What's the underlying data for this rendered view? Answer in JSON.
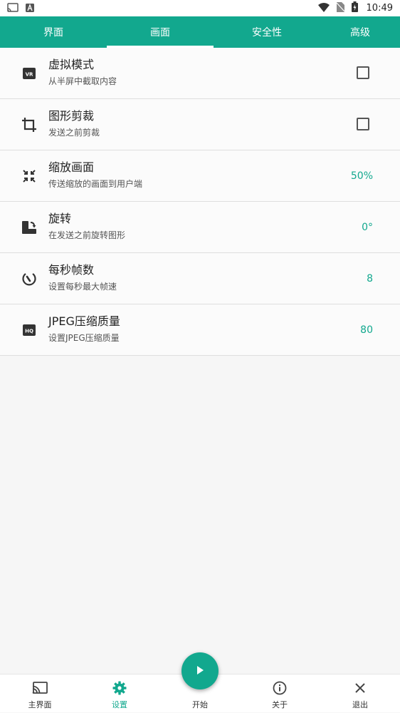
{
  "status_bar": {
    "time": "10:49",
    "left_icons": [
      "cast-icon",
      "a-notification-icon"
    ],
    "right_icons": [
      "wifi-icon",
      "no-sim-icon",
      "battery-charging-icon"
    ]
  },
  "tabs": [
    {
      "label": "界面",
      "active": false
    },
    {
      "label": "画面",
      "active": true
    },
    {
      "label": "安全性",
      "active": false
    },
    {
      "label": "高级",
      "active": false
    }
  ],
  "settings": [
    {
      "title": "虚拟模式",
      "subtitle": "从半屏中截取内容",
      "icon": "vr-icon",
      "control": "checkbox",
      "checked": false
    },
    {
      "title": "图形剪裁",
      "subtitle": "发送之前剪裁",
      "icon": "crop-icon",
      "control": "checkbox",
      "checked": false
    },
    {
      "title": "缩放画面",
      "subtitle": "传送缩放的画面到用户端",
      "icon": "zoom-in-map-icon",
      "control": "value",
      "value": "50%"
    },
    {
      "title": "旋转",
      "subtitle": "在发送之前旋转图形",
      "icon": "rotate-icon",
      "control": "value",
      "value": "0°"
    },
    {
      "title": "每秒帧数",
      "subtitle": "设置每秒最大帧速",
      "icon": "speed-gauge-icon",
      "control": "value",
      "value": "8"
    },
    {
      "title": "JPEG压缩质量",
      "subtitle": "设置JPEG压缩质量",
      "icon": "hq-icon",
      "control": "value",
      "value": "80"
    }
  ],
  "bottom_nav": [
    {
      "label": "主界面",
      "icon": "cast-icon",
      "active": false
    },
    {
      "label": "设置",
      "icon": "gear-icon",
      "active": true
    },
    {
      "label": "开始",
      "icon": "play-icon",
      "active": false
    },
    {
      "label": "关于",
      "icon": "info-icon",
      "active": false
    },
    {
      "label": "退出",
      "icon": "close-icon",
      "active": false
    }
  ],
  "colors": {
    "accent": "#12a88e",
    "background": "#f6f6f6",
    "row_background": "#fbfbfb"
  }
}
